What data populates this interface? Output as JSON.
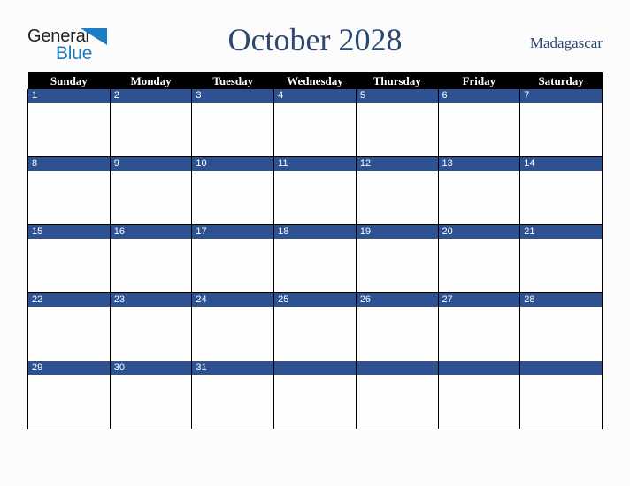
{
  "logo": {
    "word_top": "General",
    "word_bottom": "Blue",
    "triangle_icon": "blue-triangle-icon",
    "color_dark": "#231f20",
    "color_blue": "#1b7dc4"
  },
  "header": {
    "title": "October 2028",
    "country": "Madagascar",
    "title_color": "#2c4770"
  },
  "calendar": {
    "weekdays": [
      "Sunday",
      "Monday",
      "Tuesday",
      "Wednesday",
      "Thursday",
      "Friday",
      "Saturday"
    ],
    "header_bg": "#000000",
    "header_fg": "#ffffff",
    "daynum_bg": "#2e5291",
    "daynum_fg": "#ffffff",
    "cell_bg": "#fdfdfd",
    "grid_color": "#000000",
    "weeks": [
      [
        {
          "num": "1"
        },
        {
          "num": "2"
        },
        {
          "num": "3"
        },
        {
          "num": "4"
        },
        {
          "num": "5"
        },
        {
          "num": "6"
        },
        {
          "num": "7"
        }
      ],
      [
        {
          "num": "8"
        },
        {
          "num": "9"
        },
        {
          "num": "10"
        },
        {
          "num": "11"
        },
        {
          "num": "12"
        },
        {
          "num": "13"
        },
        {
          "num": "14"
        }
      ],
      [
        {
          "num": "15"
        },
        {
          "num": "16"
        },
        {
          "num": "17"
        },
        {
          "num": "18"
        },
        {
          "num": "19"
        },
        {
          "num": "20"
        },
        {
          "num": "21"
        }
      ],
      [
        {
          "num": "22"
        },
        {
          "num": "23"
        },
        {
          "num": "24"
        },
        {
          "num": "25"
        },
        {
          "num": "26"
        },
        {
          "num": "27"
        },
        {
          "num": "28"
        }
      ],
      [
        {
          "num": "29"
        },
        {
          "num": "30"
        },
        {
          "num": "31"
        },
        {
          "num": ""
        },
        {
          "num": ""
        },
        {
          "num": ""
        },
        {
          "num": ""
        }
      ]
    ]
  },
  "page": {
    "background": "#fdfcfc"
  }
}
